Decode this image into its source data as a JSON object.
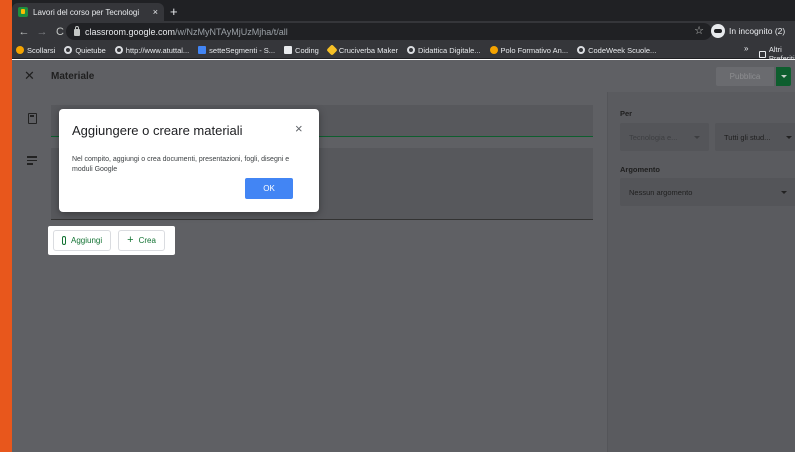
{
  "browser": {
    "tab": {
      "title": "Lavori del corso per Tecnologi",
      "close": "×"
    },
    "new_tab": "+",
    "nav": {
      "back": "←",
      "forward": "→",
      "reload": "C",
      "home": "⌂"
    },
    "address": {
      "host": "classroom.google.com",
      "path": "/w/NzMyNTAyMjUzMjha/t/all"
    },
    "star": "☆",
    "incognito_label": "In incognito (2)",
    "bookmarks": [
      {
        "label": "Scollarsi",
        "icon": "orange"
      },
      {
        "label": "Quietube",
        "icon": "ring"
      },
      {
        "label": "http://www.atuttal...",
        "icon": "ring"
      },
      {
        "label": "setteSegmenti - S...",
        "icon": "grid"
      },
      {
        "label": "Coding",
        "icon": "cw"
      },
      {
        "label": "Cruciverba Maker",
        "icon": "yellow"
      },
      {
        "label": "Didattica Digitale...",
        "icon": "ring"
      },
      {
        "label": "Polo Formativo An...",
        "icon": "orange"
      },
      {
        "label": "CodeWeek Scuole...",
        "icon": "ring"
      }
    ],
    "bookmarks_more": "»",
    "other_bookmarks": "Altri Preferiti"
  },
  "header": {
    "close": "✕",
    "title": "Materiale",
    "publish_label": "Pubblica"
  },
  "attach": {
    "add_label": "Aggiungi",
    "create_label": "Crea",
    "create_symbol": "+"
  },
  "side": {
    "for_label": "Per",
    "class_value": "Tecnologia e...",
    "students_value": "Tutti gli stud...",
    "topic_label": "Argomento",
    "topic_value": "Nessun argomento"
  },
  "dialog": {
    "title": "Aggiungere o creare materiali",
    "close": "×",
    "body": "Nel compito, aggiungi o crea documenti, presentazioni, fogli, disegni e moduli Google",
    "ok_label": "OK"
  }
}
